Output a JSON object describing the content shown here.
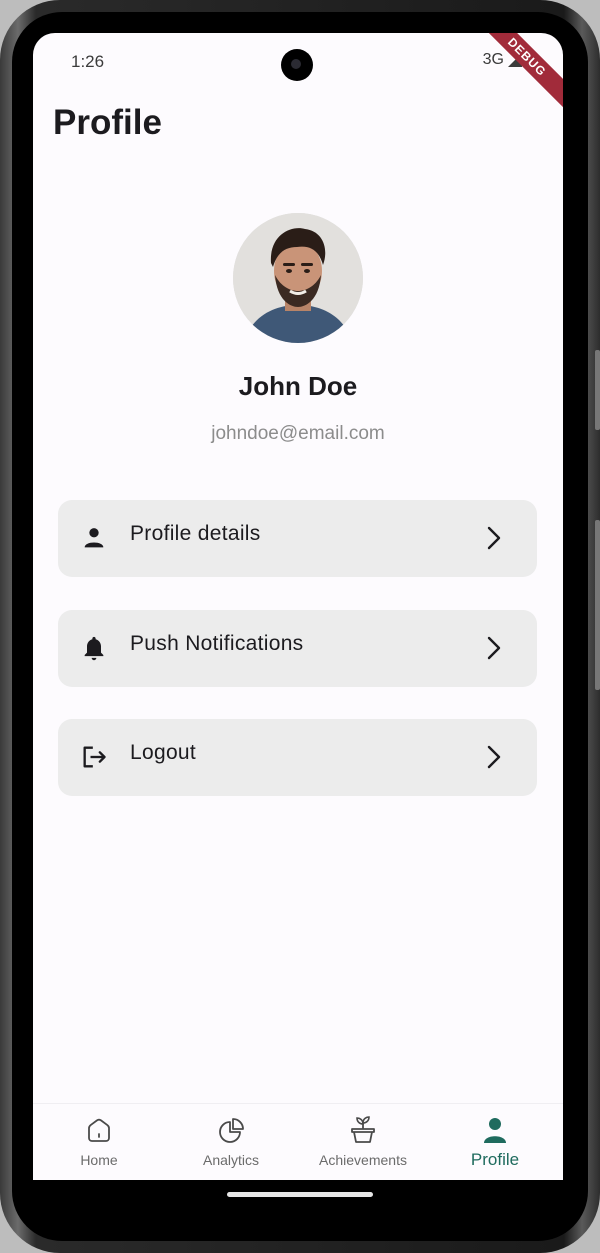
{
  "status_bar": {
    "time": "1:26",
    "network": "3G",
    "debug_label": "DEBUG"
  },
  "page": {
    "title": "Profile"
  },
  "user": {
    "name": "John Doe",
    "email": "johndoe@email.com"
  },
  "menu": {
    "items": [
      {
        "label": "Profile details",
        "icon": "person-icon"
      },
      {
        "label": "Push Notifications",
        "icon": "bell-icon"
      },
      {
        "label": "Logout",
        "icon": "logout-icon"
      }
    ]
  },
  "bottom_nav": {
    "items": [
      {
        "label": "Home",
        "icon": "home-icon"
      },
      {
        "label": "Analytics",
        "icon": "pie-chart-icon"
      },
      {
        "label": "Achievements",
        "icon": "plant-pot-icon"
      },
      {
        "label": "Profile",
        "icon": "person-icon"
      }
    ],
    "active_index": 3
  },
  "colors": {
    "accent": "#1f6b5e",
    "menu_background": "#ececec",
    "screen_background": "#fdfbfe",
    "debug_ribbon": "#a12b3a"
  }
}
